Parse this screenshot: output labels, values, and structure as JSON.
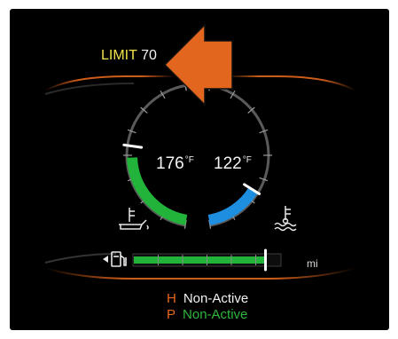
{
  "speed_limit": {
    "label": "LIMIT",
    "value": "70"
  },
  "temperatures": {
    "oil": {
      "value": "176",
      "unit": "°F",
      "level": 0.55,
      "color": "#22b43a",
      "icon": "oil-temperature-icon"
    },
    "coolant": {
      "value": "122",
      "unit": "°F",
      "level": 0.3,
      "color": "#1e8ee0",
      "icon": "coolant-temperature-icon"
    }
  },
  "fuel": {
    "unit": "mi",
    "level": 0.9,
    "color": "#22b43a",
    "icon": "fuel-pump-icon"
  },
  "status": {
    "h": {
      "key": "H",
      "value": "Non-Active"
    },
    "p": {
      "key": "P",
      "value": "Non-Active"
    }
  },
  "colors": {
    "accent_orange": "#e2661d",
    "limit_label_yellow": "#f0e24a",
    "active_green": "#2fb53e",
    "background": "#000000"
  }
}
